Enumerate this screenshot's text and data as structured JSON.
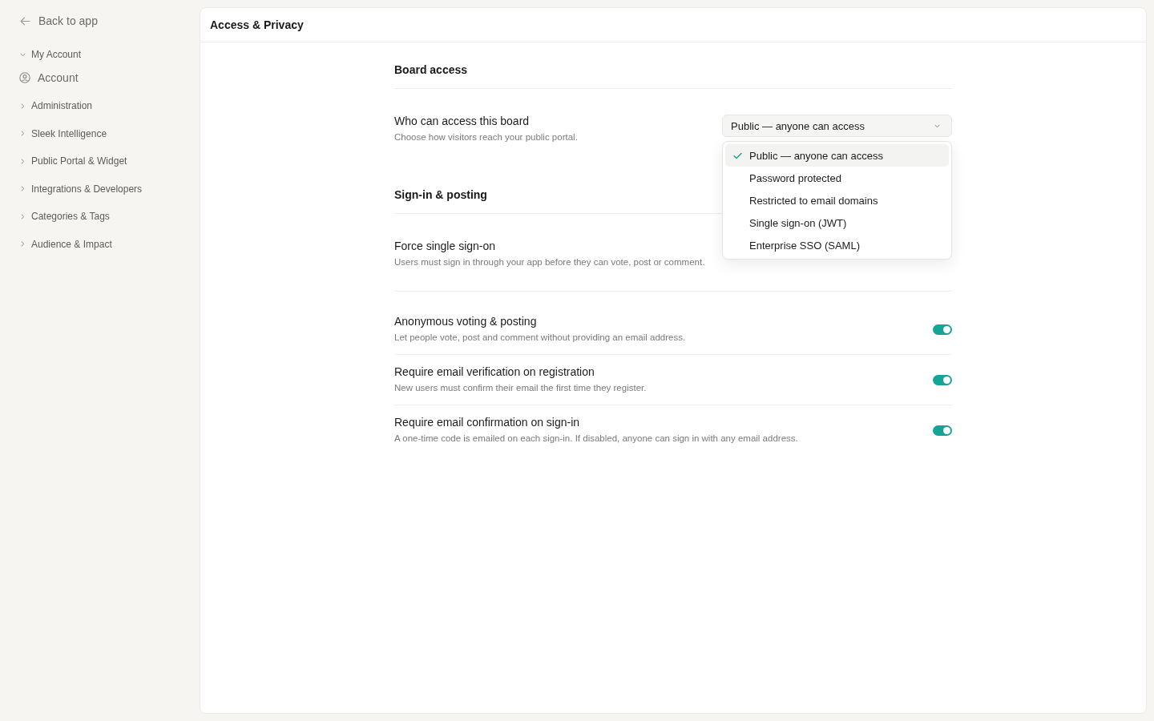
{
  "sidebar": {
    "back_link": "Back to app",
    "groups": [
      {
        "label": "My Account",
        "expanded": true,
        "children": [
          {
            "label": "Account"
          }
        ]
      },
      {
        "label": "Administration",
        "expanded": false
      },
      {
        "label": "Sleek Intelligence",
        "expanded": false
      },
      {
        "label": "Public Portal & Widget",
        "expanded": false
      },
      {
        "label": "Integrations & Developers",
        "expanded": false
      },
      {
        "label": "Categories & Tags",
        "expanded": false
      },
      {
        "label": "Audience & Impact",
        "expanded": false
      }
    ]
  },
  "panel": {
    "title": "Access & Privacy"
  },
  "sections": [
    {
      "title": "Board access",
      "rows": [
        {
          "kind": "select",
          "label": "Who can access this board",
          "description": "Choose how visitors reach your public portal.",
          "value": "Public — anyone can access",
          "menu": {
            "options": [
              {
                "label": "Public — anyone can access",
                "selected": true
              },
              {
                "label": "Password protected",
                "selected": false
              },
              {
                "label": "Restricted to email domains",
                "selected": false
              },
              {
                "label": "Single sign-on (JWT)",
                "selected": false
              },
              {
                "label": "Enterprise SSO (SAML)",
                "selected": false
              }
            ]
          }
        }
      ]
    },
    {
      "title": "Sign-in & posting",
      "rows": [
        {
          "kind": "plain",
          "label": "Force single sign-on",
          "description": "Users must sign in through your app before they can vote, post or comment."
        },
        {
          "kind": "toggle",
          "label": "Anonymous voting & posting",
          "description": "Let people vote, post and comment without providing an email address.",
          "on": true
        },
        {
          "kind": "toggle",
          "label": "Require email verification on registration",
          "description": "New users must confirm their email the first time they register.",
          "on": true
        },
        {
          "kind": "toggle",
          "label": "Require email confirmation on sign-in",
          "description": "A one-time code is emailed on each sign-in. If disabled, anyone can sign in with any email address.",
          "on": true
        }
      ]
    }
  ]
}
